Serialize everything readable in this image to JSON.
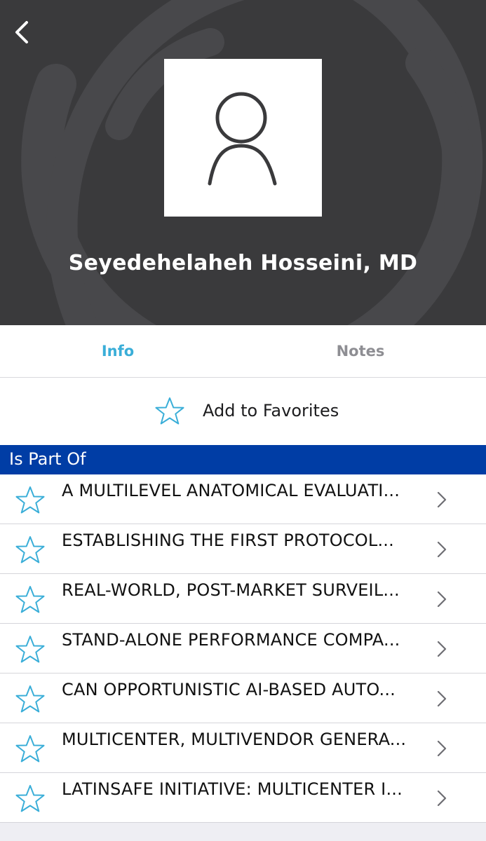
{
  "profile": {
    "name": "Seyedehelaheh Hosseini, MD"
  },
  "tabs": [
    {
      "label": "Info",
      "active": true
    },
    {
      "label": "Notes",
      "active": false
    }
  ],
  "favorites": {
    "label": "Add to Favorites"
  },
  "section": {
    "title": "Is Part Of"
  },
  "items": [
    {
      "title": "A MULTILEVEL ANATOMICAL EVALUATI..."
    },
    {
      "title": "ESTABLISHING THE FIRST PROTOCOL..."
    },
    {
      "title": "REAL-WORLD, POST-MARKET SURVEIL..."
    },
    {
      "title": "STAND-ALONE PERFORMANCE COMPA..."
    },
    {
      "title": "CAN OPPORTUNISTIC AI-BASED AUTO..."
    },
    {
      "title": "MULTICENTER, MULTIVENDOR GENERA..."
    },
    {
      "title": "LATINSAFE INITIATIVE: MULTICENTER I..."
    }
  ],
  "colors": {
    "header_bg": "#3a3a3c",
    "accent": "#3aaed8",
    "section_bg": "#003da5"
  },
  "icons": {
    "back": "chevron-left-icon",
    "avatar": "person-icon",
    "star": "star-outline-icon",
    "row_arrow": "chevron-right-icon"
  }
}
